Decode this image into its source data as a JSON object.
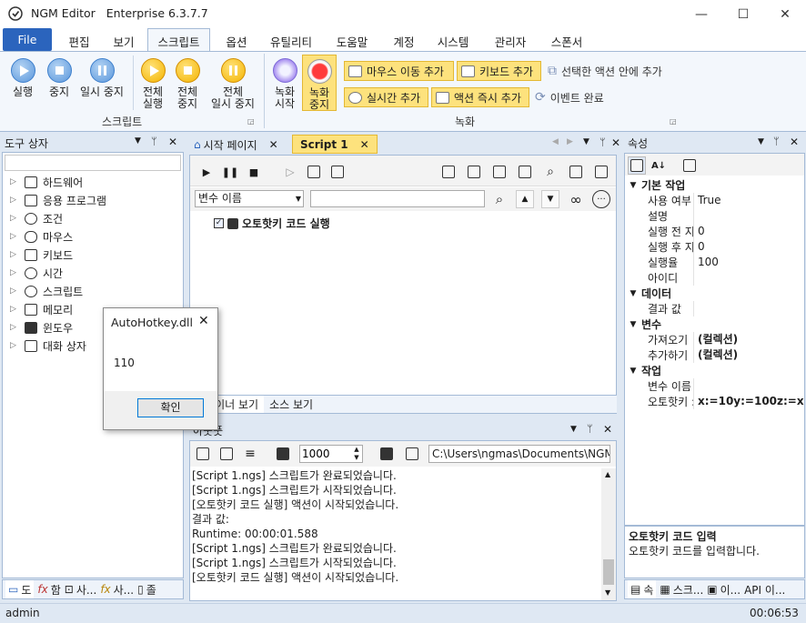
{
  "window": {
    "app_name": "NGM Editor",
    "edition": "Enterprise 6.3.7.7",
    "min": "—",
    "max": "☐",
    "close": "✕"
  },
  "menu": {
    "file": "File",
    "tabs": [
      "편집",
      "보기",
      "스크립트",
      "옵션",
      "유틸리티",
      "도움말",
      "계정",
      "시스템",
      "관리자",
      "스폰서"
    ]
  },
  "ribbon": {
    "script_buttons": [
      {
        "label1": "실행",
        "label2": ""
      },
      {
        "label1": "중지",
        "label2": ""
      },
      {
        "label1": "일시 중지",
        "label2": ""
      }
    ],
    "all_buttons": [
      {
        "label1": "전체",
        "label2": "실행"
      },
      {
        "label1": "전체",
        "label2": "중지"
      },
      {
        "label1": "전체",
        "label2": "일시 중지"
      }
    ],
    "script_group": "스크립트",
    "record_start": {
      "label1": "녹화",
      "label2": "시작"
    },
    "record_stop": {
      "label1": "녹화",
      "label2": "중지"
    },
    "mouse_add": "마우스 이동 추가",
    "keyboard_add": "키보드 추가",
    "selected_action": "선택한 액션 안에 추가",
    "realtime_add": "실시간 추가",
    "action_instant_add": "액션 즉시 추가",
    "event_done": "이벤트 완료",
    "record_group": "녹화"
  },
  "toolbox": {
    "title": "도구 상자",
    "items": [
      "하드웨어",
      "응용 프로그램",
      "조건",
      "마우스",
      "키보드",
      "시간",
      "스크립트",
      "메모리",
      "윈도우",
      "대화 상자"
    ],
    "bottom_tabs": [
      "도",
      "함",
      "사...",
      "사...",
      "졸"
    ]
  },
  "editor": {
    "tabs": [
      {
        "label": "시작 페이지",
        "close": "✕"
      },
      {
        "label": "Script 1",
        "close": "✕"
      }
    ],
    "var_select": "변수 이름",
    "action_text": "오토핫키 코드 실행",
    "bottom_tabs": [
      "디자이너 보기",
      "소스 보기"
    ]
  },
  "output": {
    "title": "아웃풋",
    "delay_value": "1000",
    "path": "C:\\Users\\ngmas\\Documents\\NGM6\\",
    "lines": [
      "[Script 1.ngs] 스크립트가 완료되었습니다.",
      "[Script 1.ngs] 스크립트가 시작되었습니다.",
      "[오토핫키 코드 실행] 액션이 시작되었습니다.",
      "결과 값:",
      "Runtime: 00:00:01.588",
      "[Script 1.ngs] 스크립트가 완료되었습니다.",
      "[Script 1.ngs] 스크립트가 시작되었습니다.",
      "[오토핫키 코드 실행] 액션이 시작되었습니다."
    ]
  },
  "properties": {
    "title": "속성",
    "categories": [
      {
        "name": "기본 작업",
        "rows": [
          {
            "k": "사용 여부",
            "v": "True"
          },
          {
            "k": "설명",
            "v": ""
          },
          {
            "k": "실행 전 지",
            "v": "0"
          },
          {
            "k": "실행 후 지",
            "v": "0"
          },
          {
            "k": "실행율",
            "v": "100"
          },
          {
            "k": "아이디",
            "v": ""
          }
        ]
      },
      {
        "name": "데이터",
        "rows": [
          {
            "k": "결과 값",
            "v": ""
          }
        ]
      },
      {
        "name": "변수",
        "rows": [
          {
            "k": "가져오기",
            "v": "(컬렉션)"
          },
          {
            "k": "추가하기",
            "v": "(컬렉션)"
          }
        ]
      },
      {
        "name": "작업",
        "rows": [
          {
            "k": "변수 이름",
            "v": ""
          },
          {
            "k": "오토핫키 :",
            "v": "x:=10y:=100z:=x+y"
          }
        ]
      }
    ],
    "desc_title": "오토핫키 코드 입력",
    "desc_text": "오토핫키 코드를 입력합니다.",
    "bottom_tabs": [
      "속",
      "스크...",
      "이...",
      "API 이..."
    ]
  },
  "status": {
    "user": "admin",
    "time": "00:06:53"
  },
  "dialog": {
    "title": "AutoHotkey.dll",
    "message": "110",
    "ok": "확인",
    "close": "✕"
  },
  "colors": {
    "accent": "#2b64bd",
    "highlight": "#fde27d",
    "panel_border": "#a4bad6"
  }
}
